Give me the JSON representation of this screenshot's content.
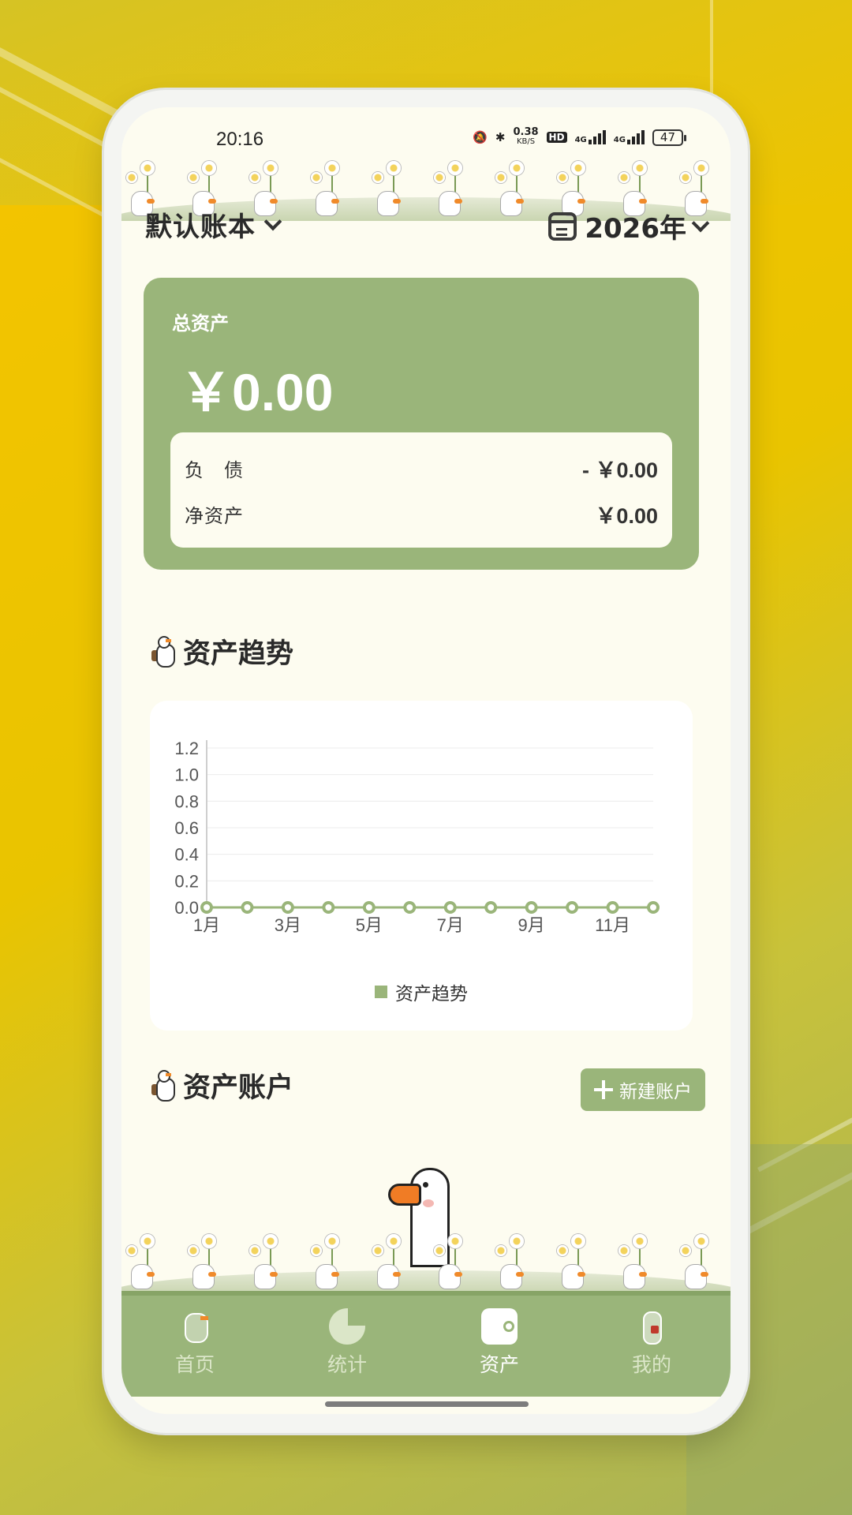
{
  "status_bar": {
    "time": "20:16",
    "net_speed": "0.38",
    "net_unit": "KB/S",
    "hd": "HD",
    "network1": "4G",
    "network2": "4G",
    "battery": "47"
  },
  "header": {
    "book_name": "默认账本",
    "year": "2026年"
  },
  "summary": {
    "total_label": "总资产",
    "total_value": "￥0.00",
    "liability_label": "负　债",
    "liability_value": "- ￥0.00",
    "net_label": "净资产",
    "net_value": "￥0.00"
  },
  "trend_section": {
    "title": "资产趋势"
  },
  "chart_data": {
    "type": "line",
    "x": [
      "1月",
      "2月",
      "3月",
      "4月",
      "5月",
      "6月",
      "7月",
      "8月",
      "9月",
      "10月",
      "11月",
      "12月"
    ],
    "x_tick_labels": [
      "1月",
      "3月",
      "5月",
      "7月",
      "9月",
      "11月"
    ],
    "series": [
      {
        "name": "资产趋势",
        "values": [
          0,
          0,
          0,
          0,
          0,
          0,
          0,
          0,
          0,
          0,
          0,
          0
        ]
      }
    ],
    "y_ticks": [
      "0.0",
      "0.2",
      "0.4",
      "0.6",
      "0.8",
      "1.0",
      "1.2"
    ],
    "ylim": [
      0,
      1.2
    ],
    "grid": true,
    "legend": "bottom",
    "color": "#9ab57a"
  },
  "accounts_section": {
    "title": "资产账户",
    "new_button": "新建账户"
  },
  "nav": {
    "items": [
      {
        "label": "首页",
        "icon": "goose-home-icon"
      },
      {
        "label": "统计",
        "icon": "pie-chart-icon"
      },
      {
        "label": "资产",
        "icon": "wallet-icon"
      },
      {
        "label": "我的",
        "icon": "goose-profile-icon"
      }
    ],
    "active": "资产"
  },
  "colors": {
    "accent": "#9ab57a",
    "background": "#fdfcf0",
    "frame_bg": "#f2c300"
  }
}
